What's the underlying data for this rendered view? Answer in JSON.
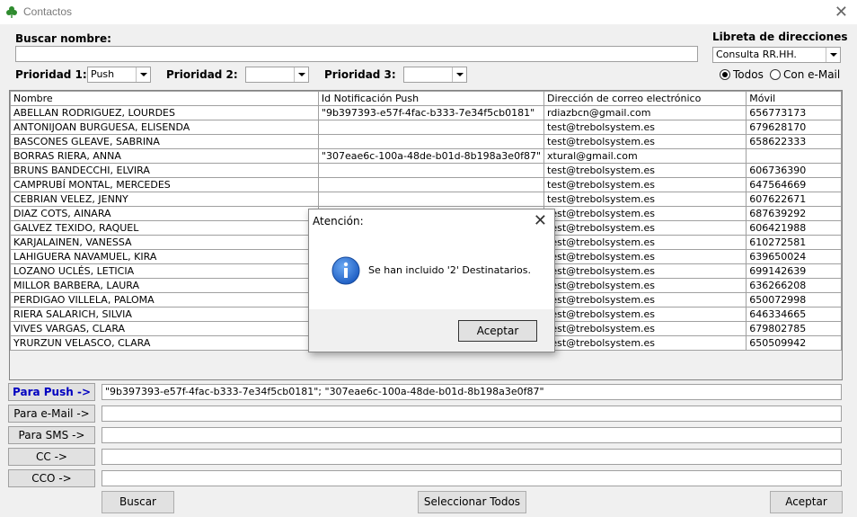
{
  "window": {
    "title": "Contactos",
    "app_icon": "clover-icon",
    "close_icon": "close-icon"
  },
  "search": {
    "label": "Buscar nombre:",
    "value": ""
  },
  "address_book": {
    "label": "Libreta de direcciones",
    "selected": "Consulta RR.HH.",
    "filter_all": "Todos",
    "filter_email": "Con e-Mail",
    "filter_selected": "Todos"
  },
  "priorities": [
    {
      "label": "Prioridad 1:",
      "value": "Push"
    },
    {
      "label": "Prioridad 2:",
      "value": ""
    },
    {
      "label": "Prioridad 3:",
      "value": ""
    }
  ],
  "grid": {
    "columns": [
      "Nombre",
      "Id Notificación Push",
      "Dirección de correo electrónico",
      "Móvil"
    ],
    "rows": [
      [
        "ABELLAN RODRIGUEZ, LOURDES",
        "\"9b397393-e57f-4fac-b333-7e34f5cb0181\"",
        "rdiazbcn@gmail.com",
        "656773173"
      ],
      [
        "ANTONIJOAN BURGUESA, ELISENDA",
        "",
        "test@trebolsystem.es",
        "679628170"
      ],
      [
        "BASCONES GLEAVE, SABRINA",
        "",
        "test@trebolsystem.es",
        "658622333"
      ],
      [
        "BORRAS RIERA, ANNA",
        "\"307eae6c-100a-48de-b01d-8b198a3e0f87\"",
        "xtural@gmail.com",
        ""
      ],
      [
        "BRUNS BANDECCHI, ELVIRA",
        "",
        "test@trebolsystem.es",
        "606736390"
      ],
      [
        "CAMPRUBÍ MONTAL, MERCEDES",
        "",
        "test@trebolsystem.es",
        "647564669"
      ],
      [
        "CEBRIAN VELEZ, JENNY",
        "",
        "test@trebolsystem.es",
        "607622671"
      ],
      [
        "DIAZ COTS, AINARA",
        "",
        "test@trebolsystem.es",
        "687639292"
      ],
      [
        "GALVEZ TEXIDO, RAQUEL",
        "",
        "test@trebolsystem.es",
        "606421988"
      ],
      [
        "KARJALAINEN, VANESSA",
        "",
        "test@trebolsystem.es",
        "610272581"
      ],
      [
        "LAHIGUERA NAVAMUEL, KIRA",
        "",
        "test@trebolsystem.es",
        "639650024"
      ],
      [
        "LOZANO UCLÉS, LETICIA",
        "",
        "test@trebolsystem.es",
        "699142639"
      ],
      [
        "MILLOR BARBERA, LAURA",
        "",
        "test@trebolsystem.es",
        "636266208"
      ],
      [
        "PERDIGAO VILLELA, PALOMA",
        "",
        "test@trebolsystem.es",
        "650072998"
      ],
      [
        "RIERA SALARICH, SILVIA",
        "",
        "test@trebolsystem.es",
        "646334665"
      ],
      [
        "VIVES VARGAS, CLARA",
        "",
        "test@trebolsystem.es",
        "679802785"
      ],
      [
        "YRURZUN VELASCO, CLARA",
        "",
        "test@trebolsystem.es",
        "650509942"
      ]
    ]
  },
  "send": [
    {
      "label": "Para Push ->",
      "value": "\"9b397393-e57f-4fac-b333-7e34f5cb0181\"; \"307eae6c-100a-48de-b01d-8b198a3e0f87\""
    },
    {
      "label": "Para e-Mail ->",
      "value": ""
    },
    {
      "label": "Para SMS ->",
      "value": ""
    },
    {
      "label": "CC ->",
      "value": ""
    },
    {
      "label": "CCO ->",
      "value": ""
    }
  ],
  "buttons": {
    "search": "Buscar",
    "select_all": "Seleccionar Todos",
    "accept": "Aceptar"
  },
  "dialog": {
    "title": "Atención:",
    "message": "Se han incluido '2' Destinatarios.",
    "ok": "Aceptar",
    "icon": "info-icon"
  },
  "colors": {
    "push_label": "#0000c0",
    "info_icon": "#1f5fc4"
  }
}
